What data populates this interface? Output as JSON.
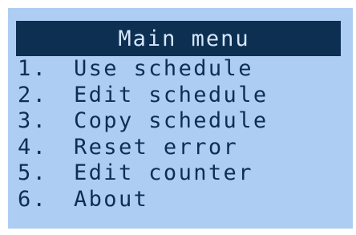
{
  "menu": {
    "title": "Main menu",
    "items": [
      {
        "number": "1.",
        "label": "Use schedule"
      },
      {
        "number": "2.",
        "label": "Edit schedule"
      },
      {
        "number": "3.",
        "label": "Copy schedule"
      },
      {
        "number": "4.",
        "label": "Reset error"
      },
      {
        "number": "5.",
        "label": "Edit counter"
      },
      {
        "number": "6.",
        "label": "About"
      }
    ]
  },
  "colors": {
    "background": "#aecdf2",
    "title_bar": "#0c2f52",
    "title_text": "#d6e6f9",
    "item_text": "#0c2f52"
  }
}
